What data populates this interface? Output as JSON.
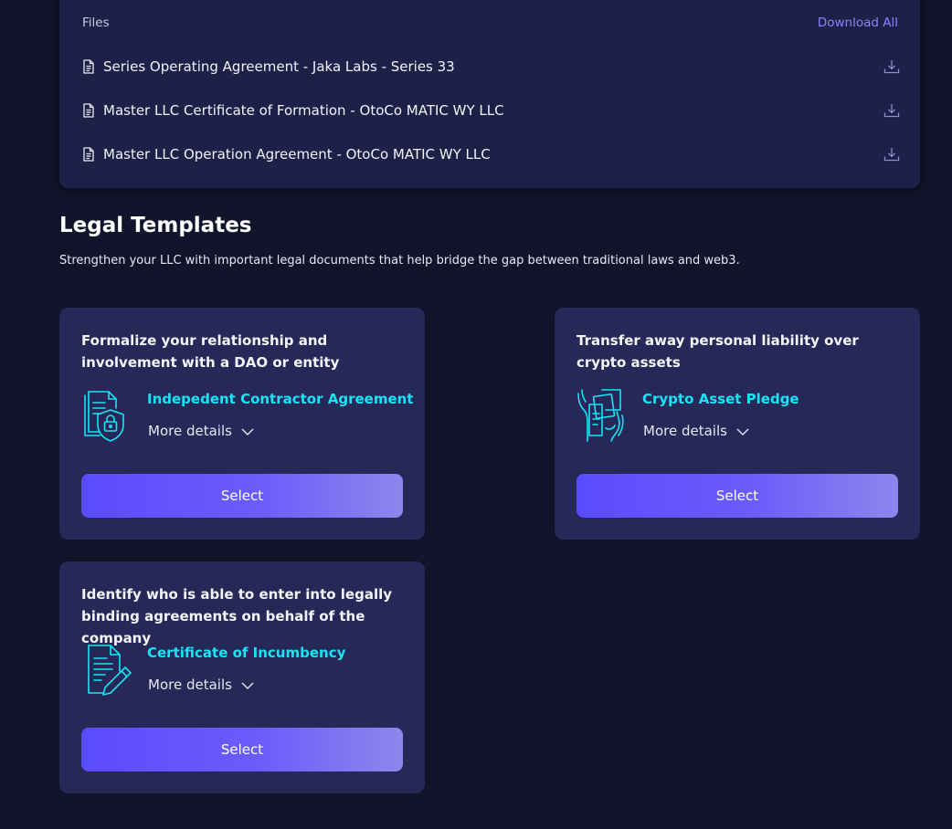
{
  "files": {
    "title": "Files",
    "download_all": "Download All",
    "items": [
      {
        "name": "Series Operating Agreement - Jaka Labs - Series 33"
      },
      {
        "name": "Master LLC Certificate of Formation - OtoCo MATIC WY LLC"
      },
      {
        "name": "Master LLC Operation Agreement - OtoCo MATIC WY LLC"
      }
    ]
  },
  "legal_templates": {
    "title": "Legal Templates",
    "description": "Strengthen your LLC with important legal documents that help bridge the gap between traditional laws and web3.",
    "cards": [
      {
        "description": "Formalize your relationship and involvement with a DAO or entity",
        "name": "Indepedent Contractor Agreement",
        "icon": "document-lock-icon",
        "more_details": "More details",
        "select_label": "Select"
      },
      {
        "description": "Transfer away personal liability over crypto assets",
        "name": "Crypto Asset Pledge",
        "icon": "hand-document-icon",
        "more_details": "More details",
        "select_label": "Select"
      },
      {
        "description": "Identify who is able to enter into legally binding agreements on behalf of the company",
        "name": "Certificate of Incumbency",
        "icon": "document-pen-icon",
        "more_details": "More details",
        "select_label": "Select"
      }
    ]
  },
  "colors": {
    "background": "#11142b",
    "panel": "#1d2147",
    "card": "#262958",
    "accent_cyan": "#17e5f6",
    "accent_purple": "#8b83ff",
    "button_gradient_start": "#5b4bff",
    "button_gradient_end": "#8e86ec"
  }
}
